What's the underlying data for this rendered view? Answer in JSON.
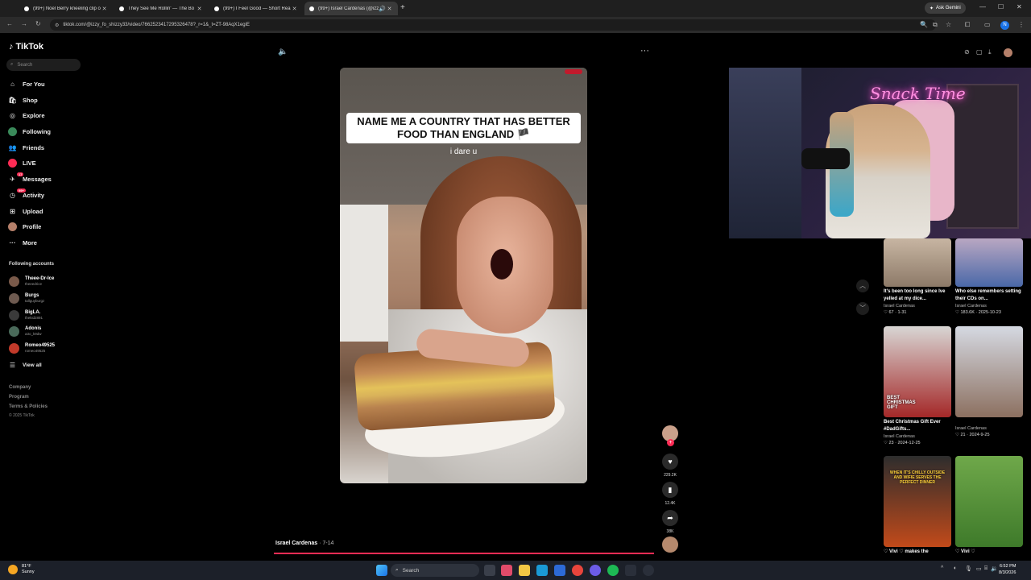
{
  "browser": {
    "tabs": [
      {
        "title": "(99+) Noel Berry kneeling clip o"
      },
      {
        "title": "They See Me Rollin' — The Bo"
      },
      {
        "title": "(99+) I Feel Good — Short Rea"
      },
      {
        "title": "(99+) Israel Cardenas (@izzy"
      }
    ],
    "ask_gemini": "Ask Gemini",
    "url": "tiktok.com/@izzy_fo_shizzy33/video/7662523417295326478?_r=1&_t=ZT-98AqX1egiE",
    "profile_initial": "N"
  },
  "sidebar": {
    "logo": "TikTok",
    "search_placeholder": "Search",
    "nav": [
      {
        "label": "For You",
        "icon": "home-icon"
      },
      {
        "label": "Shop",
        "icon": "shop-icon"
      },
      {
        "label": "Explore",
        "icon": "compass-icon"
      },
      {
        "label": "Following",
        "icon": "following-icon"
      },
      {
        "label": "Friends",
        "icon": "friends-icon"
      },
      {
        "label": "LIVE",
        "icon": "live-icon"
      },
      {
        "label": "Messages",
        "icon": "messages-icon",
        "badge": "17"
      },
      {
        "label": "Activity",
        "icon": "activity-icon",
        "badge": "99+"
      },
      {
        "label": "Upload",
        "icon": "upload-icon"
      },
      {
        "label": "Profile",
        "icon": "profile-icon"
      },
      {
        "label": "More",
        "icon": "more-icon"
      }
    ],
    "following_title": "Following accounts",
    "accounts": [
      {
        "name": "Theee-Dr-Ice",
        "handle": "theeedrice",
        "color": "#7a5a4a"
      },
      {
        "name": "Burgs",
        "handle": "tallguyburgz",
        "color": "#6e5a50"
      },
      {
        "name": "BigLA.",
        "handle": "thekid2891",
        "color": "#3a3a3a"
      },
      {
        "name": "Adonis",
        "handle": "a3o_k9dw",
        "color": "#4a6a5a"
      },
      {
        "name": "Romeo49525",
        "handle": "romeo49525",
        "color": "#c23a2a"
      }
    ],
    "view_all": "View all",
    "footer": [
      "Company",
      "Program",
      "Terms & Policies"
    ],
    "copyright": "© 2025 TikTok"
  },
  "video": {
    "caption": "NAME ME A COUNTRY THAT HAS BETTER FOOD THAN ENGLAND 🏴",
    "subcaption": "i dare u",
    "author": "Israel Cardenas",
    "date": " · 7-14",
    "likes": "229.2K",
    "saves": "12.4K",
    "shares": "38K"
  },
  "webcam": {
    "neon_sign": "Snack Time"
  },
  "recommendations": [
    {
      "title": "It's been too long since Ive yelled at my dice...",
      "author": "Israel Cardenas",
      "stats": "♡ 67 · 1-31",
      "bg": "linear-gradient(180deg,#c7b5a2,#8d7a68)"
    },
    {
      "title": "Who else remembers setting their CDs on...",
      "author": "Israel Cardenas",
      "stats": "♡ 183.6K · 2025-10-23",
      "bg": "linear-gradient(180deg,#b9a7c2,#4a68a8)"
    },
    {
      "title": "Best Christmas Gift Ever #DadGifts...",
      "author": "Israel Cardenas",
      "stats": "♡ 23 · 2024-12-25",
      "bg": "linear-gradient(180deg,#d8d6d4,#a42828)",
      "tag": "BEST CHRISTMAS GIFT"
    },
    {
      "title": "",
      "author": "Israel Cardenas",
      "stats": "♡ 21 · 2024-9-25",
      "bg": "linear-gradient(180deg,#d5d9e2,#8c7060)"
    },
    {
      "title": "♡ Vivi ♡ makes the",
      "author": "",
      "stats": "",
      "bg": "linear-gradient(180deg,#2d2d2d,#c24a1a)",
      "tag": "WHEN IT'S CHILLY OUTSIDE AND WIFIE SERVES THE PERFECT DINNER"
    },
    {
      "title": "♡ Vivi ♡",
      "author": "",
      "stats": "",
      "bg": "linear-gradient(180deg,#6fa84a,#3e7a2a)"
    }
  ],
  "taskbar": {
    "weather_temp": "81°F",
    "weather_desc": "Sunny",
    "search": "Search",
    "time": "6:52 PM",
    "date": "8/3/2026"
  }
}
